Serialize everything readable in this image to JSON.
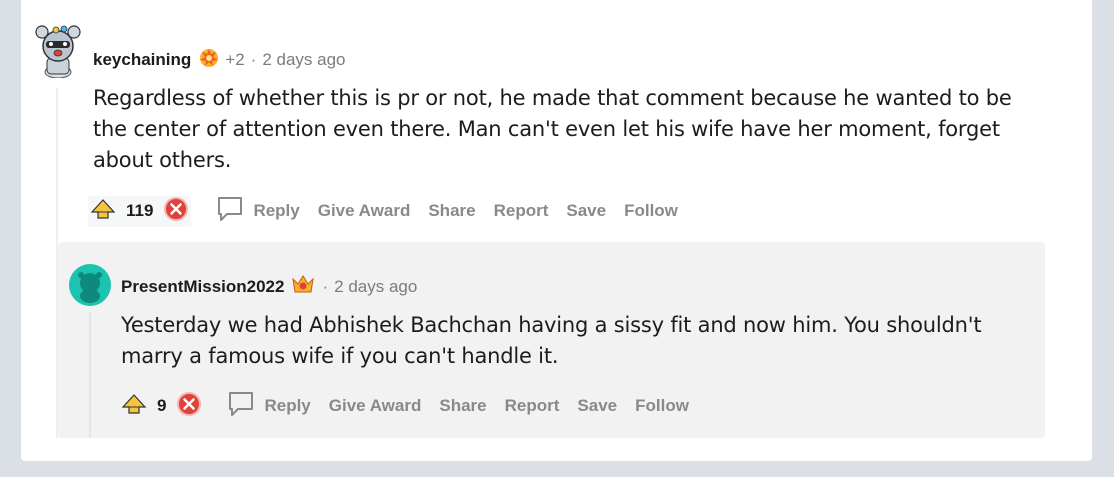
{
  "comment1": {
    "username": "keychaining",
    "extra_awards": "+2",
    "time": "2 days ago",
    "text": "Regardless of whether this is pr or not, he made that comment because he wanted to be the center of attention even there. Man can't even let his wife have her moment, forget about others.",
    "score": "119"
  },
  "comment2": {
    "username": "PresentMission2022",
    "time": "2 days ago",
    "text": "Yesterday we had Abhishek Bachchan having a sissy fit and now him. You shouldn't marry a famous wife if you can't handle it.",
    "score": "9"
  },
  "actions": {
    "reply": "Reply",
    "give_award": "Give Award",
    "share": "Share",
    "report": "Report",
    "save": "Save",
    "follow": "Follow"
  },
  "icons": [
    "avatar",
    "award-icon",
    "upvote-icon",
    "downvote-icon",
    "reply-bubble-icon"
  ],
  "colors": {
    "accent_teal": "#1bc3b0",
    "downvote_red": "#e0413a",
    "muted": "#878a8c"
  }
}
